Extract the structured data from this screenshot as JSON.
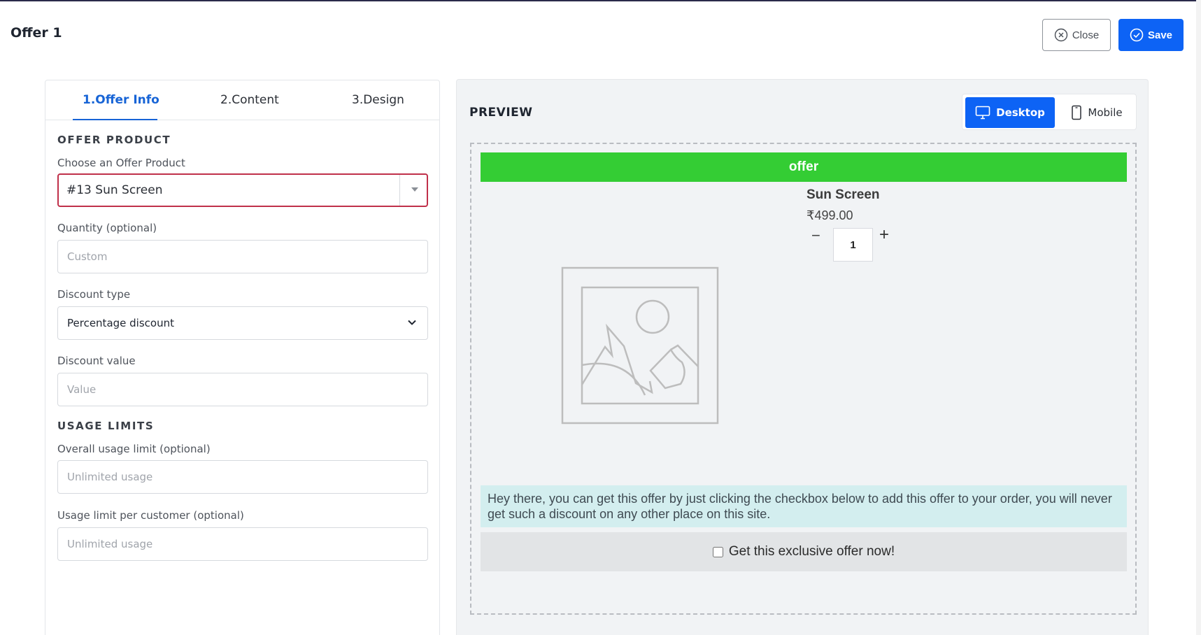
{
  "header": {
    "title": "Offer 1",
    "close_label": "Close",
    "save_label": "Save"
  },
  "tabs": [
    {
      "label": "1.Offer Info",
      "active": true
    },
    {
      "label": "2.Content",
      "active": false
    },
    {
      "label": "3.Design",
      "active": false
    }
  ],
  "form": {
    "offer_product_heading": "OFFER PRODUCT",
    "choose_product_label": "Choose an Offer Product",
    "choose_product_value": "#13 Sun Screen",
    "quantity_label": "Quantity (optional)",
    "quantity_placeholder": "Custom",
    "discount_type_label": "Discount type",
    "discount_type_value": "Percentage discount",
    "discount_value_label": "Discount value",
    "discount_value_placeholder": "Value",
    "usage_limits_heading": "USAGE LIMITS",
    "overall_limit_label": "Overall usage limit (optional)",
    "overall_limit_placeholder": "Unlimited usage",
    "per_customer_label": "Usage limit per customer (optional)",
    "per_customer_placeholder": "Unlimited usage"
  },
  "preview": {
    "title": "PREVIEW",
    "desktop_label": "Desktop",
    "mobile_label": "Mobile",
    "banner_text": "offer",
    "product_name": "Sun Screen",
    "product_price": "₹499.00",
    "quantity": "1",
    "minus_symbol": "−",
    "plus_symbol": "+",
    "description": "Hey there, you can get this offer by just clicking the checkbox below to add this offer to your order, you will never get such a discount on any other place on this site.",
    "cta_label": "Get this exclusive offer now!"
  },
  "colors": {
    "primary": "#0d63f5",
    "banner_green": "#34cd34",
    "active_tab": "#1764d6",
    "error_border": "#c0304a",
    "description_bg": "#d3eeef"
  }
}
